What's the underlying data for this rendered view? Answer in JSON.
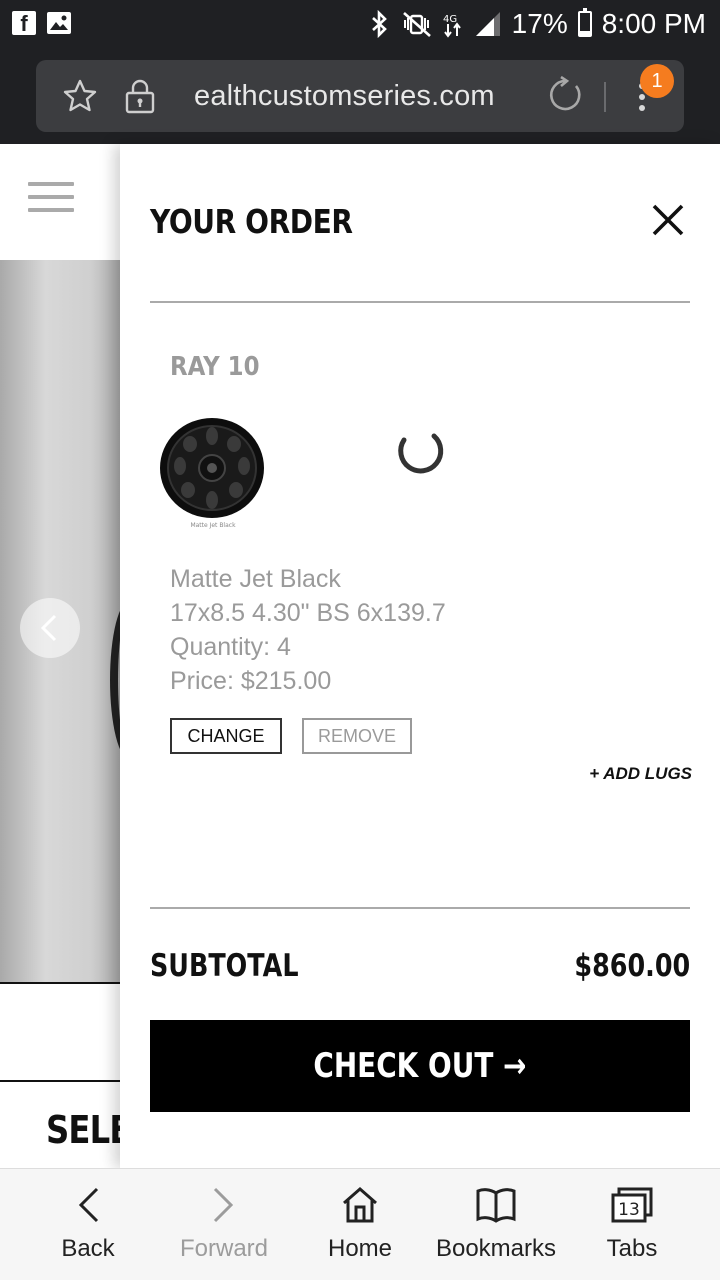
{
  "status_bar": {
    "battery": "17%",
    "time": "8:00 PM",
    "battery_level": 0.17
  },
  "browser": {
    "url": "ealthcustomseries.com",
    "menu_badge": "1"
  },
  "drawer": {
    "title": "YOUR ORDER",
    "item": {
      "name": "RAY 10",
      "image_caption": "Matte Jet Black",
      "finish": "Matte Jet Black",
      "spec": "17x8.5 4.30\" BS 6x139.7",
      "quantity": "Quantity: 4",
      "price": "Price: $215.00"
    },
    "change_label": "CHANGE",
    "remove_label": "REMOVE",
    "add_lugs_label": "+ ADD LUGS",
    "subtotal_label": "SUBTOTAL",
    "subtotal_value": "$860.00",
    "checkout_label": "CHECK OUT →"
  },
  "background_page": {
    "select_text": "SELE"
  },
  "bottom_nav": {
    "back": "Back",
    "forward": "Forward",
    "home": "Home",
    "bookmarks": "Bookmarks",
    "tabs": "Tabs",
    "tabs_count": "13"
  },
  "colors": {
    "badge": "#f57c1f",
    "status_bar": "#1f2023",
    "checkout_bg": "#000000"
  }
}
